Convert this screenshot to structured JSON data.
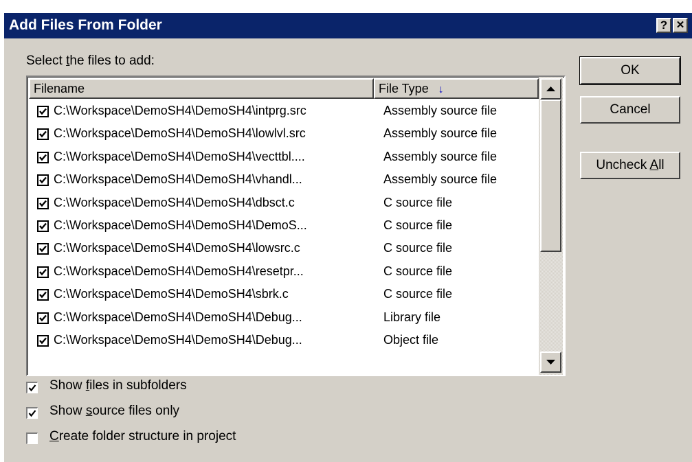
{
  "window": {
    "title": "Add Files From Folder",
    "help_button": "?",
    "close_button": "✕"
  },
  "prompt": {
    "pre": "Select ",
    "accel": "t",
    "post": "he files to add:"
  },
  "list": {
    "columns": [
      "Filename",
      "File Type"
    ],
    "sort_indicator": "↓",
    "rows": [
      {
        "checked": true,
        "filename": "C:\\Workspace\\DemoSH4\\DemoSH4\\intprg.src",
        "type": "Assembly source file"
      },
      {
        "checked": true,
        "filename": "C:\\Workspace\\DemoSH4\\DemoSH4\\lowlvl.src",
        "type": "Assembly source file"
      },
      {
        "checked": true,
        "filename": "C:\\Workspace\\DemoSH4\\DemoSH4\\vecttbl....",
        "type": "Assembly source file"
      },
      {
        "checked": true,
        "filename": "C:\\Workspace\\DemoSH4\\DemoSH4\\vhandl...",
        "type": "Assembly source file"
      },
      {
        "checked": true,
        "filename": "C:\\Workspace\\DemoSH4\\DemoSH4\\dbsct.c",
        "type": "C source file"
      },
      {
        "checked": true,
        "filename": "C:\\Workspace\\DemoSH4\\DemoSH4\\DemoS...",
        "type": "C source file"
      },
      {
        "checked": true,
        "filename": "C:\\Workspace\\DemoSH4\\DemoSH4\\lowsrc.c",
        "type": "C source file"
      },
      {
        "checked": true,
        "filename": "C:\\Workspace\\DemoSH4\\DemoSH4\\resetpr...",
        "type": "C source file"
      },
      {
        "checked": true,
        "filename": "C:\\Workspace\\DemoSH4\\DemoSH4\\sbrk.c",
        "type": "C source file"
      },
      {
        "checked": true,
        "filename": "C:\\Workspace\\DemoSH4\\DemoSH4\\Debug...",
        "type": "Library file"
      },
      {
        "checked": true,
        "filename": "C:\\Workspace\\DemoSH4\\DemoSH4\\Debug...",
        "type": "Object file"
      }
    ]
  },
  "buttons": {
    "ok": "OK",
    "cancel": "Cancel",
    "uncheck_pre": "Uncheck ",
    "uncheck_accel": "A",
    "uncheck_post": "ll"
  },
  "options": {
    "subfolders": {
      "checked": true,
      "pre": "Show ",
      "accel": "f",
      "post": "iles in subfolders"
    },
    "source_only": {
      "checked": true,
      "pre": "Show ",
      "accel": "s",
      "post": "ource files only"
    },
    "folder_structure": {
      "checked": false,
      "pre": "",
      "accel": "C",
      "post": "reate folder structure in project"
    }
  },
  "colors": {
    "titlebar": "#0a246a",
    "face": "#d4d0c8",
    "sort_arrow": "#0000c0"
  }
}
